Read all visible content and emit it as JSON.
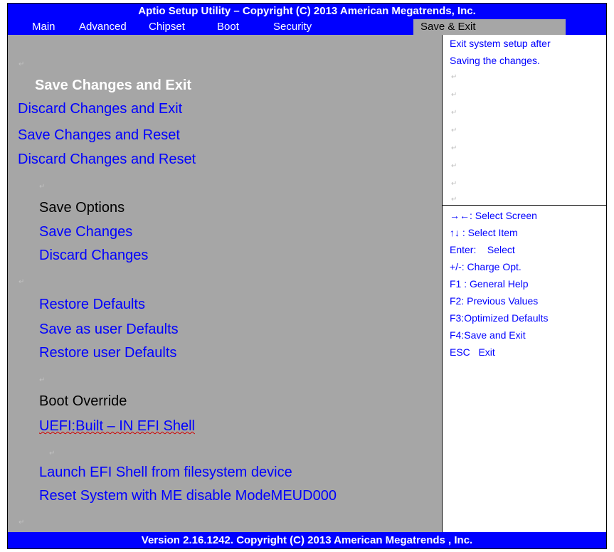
{
  "window": {
    "title": "Aptio Setup Utility – Copyright (C) 2013 American Megatrends, Inc.",
    "footer": "Version 2.16.1242. Copyright (C) 2013 American Megatrends , Inc."
  },
  "tabs": [
    {
      "label": "Main"
    },
    {
      "label": "Advanced"
    },
    {
      "label": "Chipset"
    },
    {
      "label": "Boot"
    },
    {
      "label": "Security"
    },
    {
      "label": "Save & Exit",
      "active": true
    }
  ],
  "left": {
    "save_changes_and_exit": "Save Changes and Exit",
    "discard_changes_and_exit": "Discard Changes and Exit",
    "save_changes_and_reset": "Save Changes and Reset",
    "discard_changes_and_reset": "Discard Changes and Reset",
    "save_options_heading": "Save Options",
    "save_changes": "Save Changes",
    "discard_changes": "Discard Changes",
    "restore_defaults": "Restore Defaults",
    "save_as_user_defaults": "Save as user Defaults",
    "restore_user_defaults": "Restore user Defaults",
    "boot_override_heading": "Boot Override",
    "uefi_shell": "UEFI:Built – IN EFI Shell",
    "launch_efi_shell": "Launch EFI Shell from filesystem device",
    "reset_system": "Reset System with ME disable ModeMEUD000"
  },
  "help": {
    "description_line1": "Exit system setup after",
    "description_line2": "Saving the changes.",
    "keys": [
      "→←: Select Screen",
      "↑↓    : Select Item",
      "Enter:    Select",
      "+/-: Charge Opt.",
      "F1 : General Help",
      "F2: Previous Values",
      "F3:Optimized Defaults",
      "F4:Save and Exit",
      "ESC   Exit"
    ]
  },
  "colors": {
    "bar_blue": "#0000ff",
    "panel_gray": "#a6a6a6",
    "text_blue": "#0000ff"
  },
  "glyphs": {
    "paragraph_mark": "↵"
  }
}
